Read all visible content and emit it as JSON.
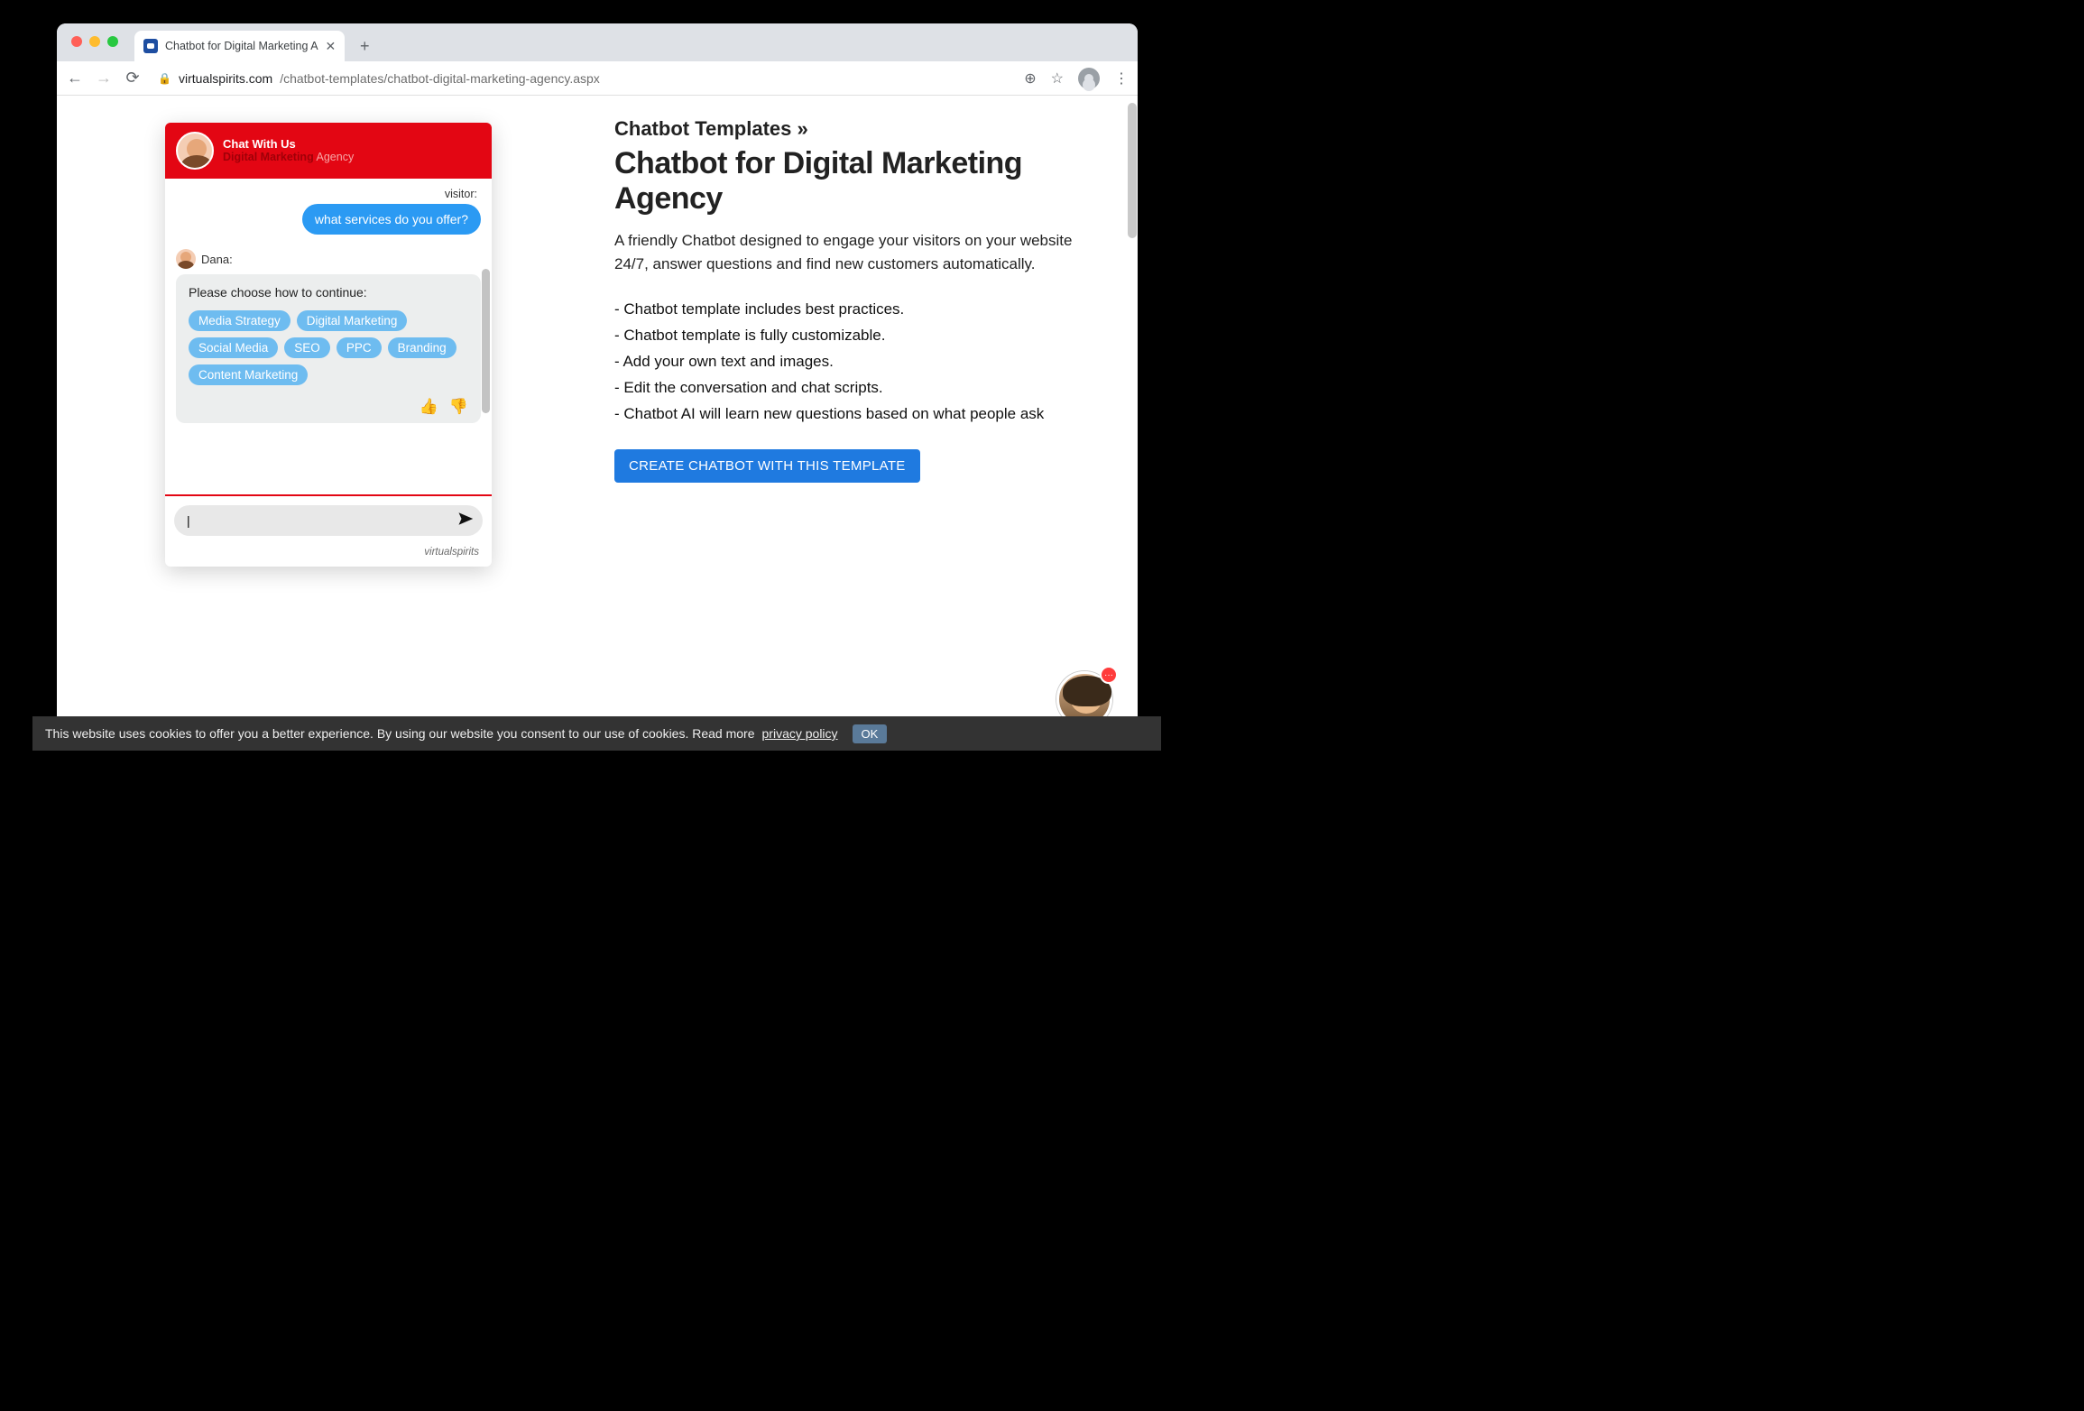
{
  "browser": {
    "tab_title": "Chatbot for Digital Marketing A",
    "url_host": "virtualspirits.com",
    "url_path": "/chatbot-templates/chatbot-digital-marketing-agency.aspx"
  },
  "chat": {
    "header_title": "Chat With Us",
    "header_sub_bold": "Digital Marketing",
    "header_sub_faded": " Agency",
    "visitor_label": "visitor:",
    "visitor_msg": "what services do you offer?",
    "agent_name": "Dana:",
    "agent_prompt": "Please choose how to continue:",
    "chips": [
      "Media Strategy",
      "Digital Marketing",
      "Social Media",
      "SEO",
      "PPC",
      "Branding",
      "Content Marketing"
    ],
    "input_value": "|",
    "powered": "virtualspirits"
  },
  "page": {
    "breadcrumb": "Chatbot Templates »",
    "title": "Chatbot for Digital Marketing Agency",
    "lead": "A friendly Chatbot designed to engage your visitors on your website 24/7, answer questions and find new customers automatically.",
    "bullets": [
      "- Chatbot template includes best practices.",
      "- Chatbot template is fully customizable.",
      "- Add your own text and images.",
      "- Edit the conversation and chat scripts.",
      "- Chatbot AI will learn new questions based on what people ask"
    ],
    "cta": "CREATE CHATBOT WITH THIS TEMPLATE"
  },
  "cookie": {
    "text": "This website uses cookies to offer you a better experience. By using our website you consent to our use of cookies. Read more ",
    "link": "privacy policy",
    "ok": "OK"
  },
  "support_badge": "···"
}
